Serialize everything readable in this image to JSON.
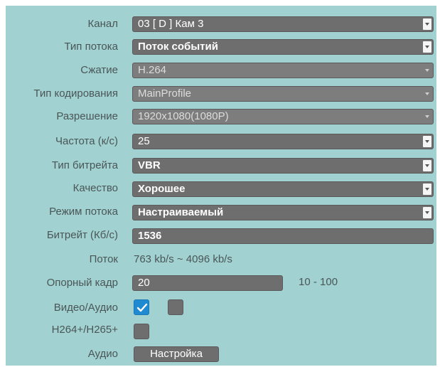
{
  "fields": {
    "channel": {
      "label": "Канал",
      "value": "03 [ D ] Кам 3"
    },
    "stream_type": {
      "label": "Тип потока",
      "value": "Поток событий"
    },
    "compression": {
      "label": "Сжатие",
      "value": "H.264"
    },
    "encoding_type": {
      "label": "Тип кодирования",
      "value": "MainProfile"
    },
    "resolution": {
      "label": "Разрешение",
      "value": "1920x1080(1080P)"
    },
    "frame_rate": {
      "label": "Частота (к/с)",
      "value": "25"
    },
    "bitrate_type": {
      "label": "Тип битрейта",
      "value": "VBR"
    },
    "quality": {
      "label": "Качество",
      "value": "Хорошее"
    },
    "stream_mode": {
      "label": "Режим потока",
      "value": "Настраиваемый"
    },
    "bitrate": {
      "label": "Битрейт (Кб/с)",
      "value": "1536"
    },
    "stream": {
      "label": "Поток",
      "value": "763 kb/s ~ 4096 kb/s"
    },
    "key_frame": {
      "label": "Опорный кадр",
      "value": "20",
      "range": "10 - 100"
    },
    "video_audio": {
      "label": "Видео/Аудио",
      "video_checked": true,
      "audio_checked": false
    },
    "h264plus": {
      "label": "H264+/H265+",
      "checked": false
    },
    "audio": {
      "label": "Аудио",
      "button": "Настройка"
    }
  },
  "colors": {
    "background": "#a2d1d1",
    "control": "#6e6e6e",
    "checked": "#1f8ad1"
  }
}
